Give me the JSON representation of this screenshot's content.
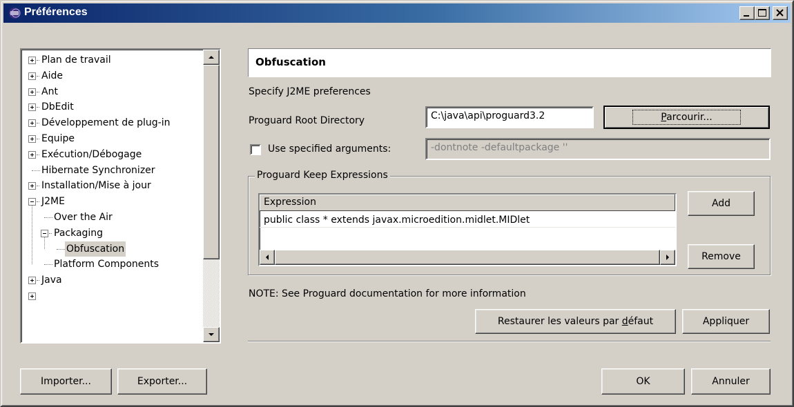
{
  "window": {
    "title": "Préférences"
  },
  "tree": {
    "items": [
      {
        "label": "Plan de travail",
        "expander": "plus"
      },
      {
        "label": "Aide",
        "expander": "plus"
      },
      {
        "label": "Ant",
        "expander": "plus"
      },
      {
        "label": "DbEdit",
        "expander": "plus"
      },
      {
        "label": "Développement de plug-in",
        "expander": "plus"
      },
      {
        "label": "Equipe",
        "expander": "plus"
      },
      {
        "label": "Exécution/Débogage",
        "expander": "plus"
      },
      {
        "label": "Hibernate Synchronizer",
        "expander": "none"
      },
      {
        "label": "Installation/Mise à jour",
        "expander": "plus"
      },
      {
        "label": "J2ME",
        "expander": "minus"
      },
      {
        "label": "Over the Air",
        "expander": "none"
      },
      {
        "label": "Packaging",
        "expander": "minus"
      },
      {
        "label": "Obfuscation",
        "expander": "none",
        "selected": true
      },
      {
        "label": "Platform Components",
        "expander": "none"
      },
      {
        "label": "Java",
        "expander": "plus"
      }
    ]
  },
  "page": {
    "title": "Obfuscation",
    "description": "Specify J2ME preferences",
    "root_dir_label": "Proguard Root Directory",
    "root_dir_value": "C:\\java\\api\\proguard3.2",
    "browse_label_pre": "",
    "browse_label_u": "P",
    "browse_label_post": "arcourir...",
    "use_args_label": "Use specified arguments:",
    "use_args_checked": false,
    "args_value": "-dontnote -defaultpackage ''",
    "keep_group_title": "Proguard Keep Expressions",
    "table_header": "Expression",
    "table_rows": [
      "public class * extends javax.microedition.midlet.MIDlet"
    ],
    "add_label": "Add",
    "remove_label": "Remove",
    "note": "NOTE: See Proguard documentation for more information",
    "restore_pre": "Restaurer les valeurs par ",
    "restore_u": "d",
    "restore_post": "éfaut",
    "apply_label": "Appliquer"
  },
  "footer": {
    "import_label": "Importer...",
    "export_label": "Exporter...",
    "ok_label": "OK",
    "cancel_label": "Annuler"
  },
  "colors": {
    "face": "#d4d0c8",
    "title_start": "#0a246a",
    "title_end": "#a6caf0"
  }
}
